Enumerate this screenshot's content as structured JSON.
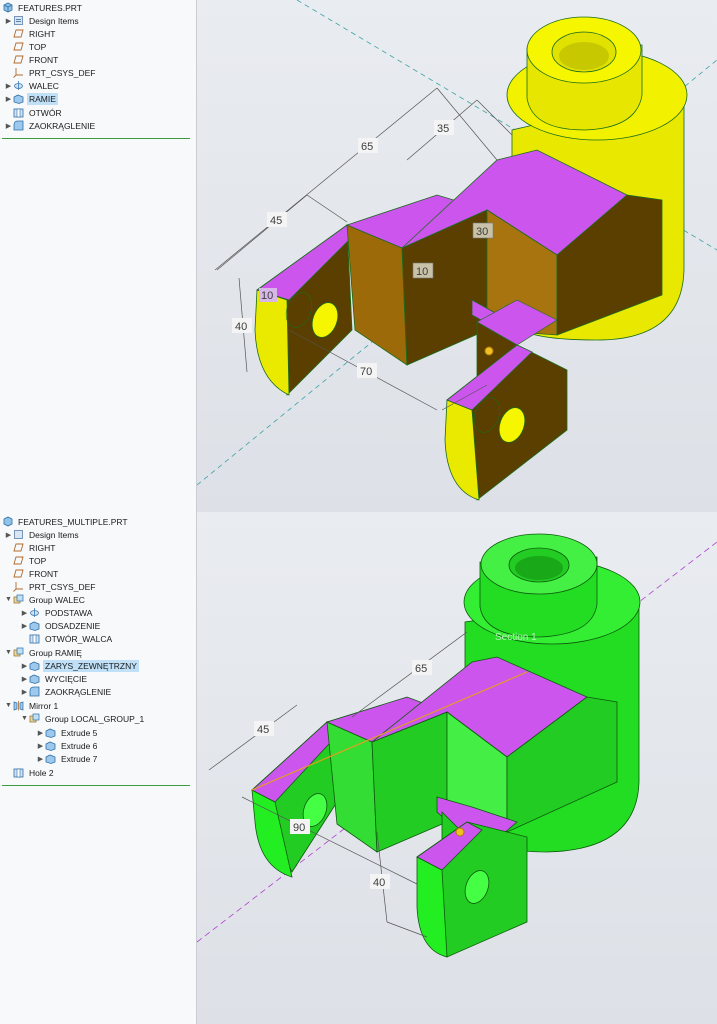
{
  "top": {
    "tree": {
      "root": "FEATURES.PRT",
      "items": [
        {
          "label": "Design Items",
          "icon": "design-items-icon"
        },
        {
          "label": "RIGHT",
          "icon": "datum-plane-icon"
        },
        {
          "label": "TOP",
          "icon": "datum-plane-icon"
        },
        {
          "label": "FRONT",
          "icon": "datum-plane-icon"
        },
        {
          "label": "PRT_CSYS_DEF",
          "icon": "csys-icon"
        },
        {
          "label": "WALEC",
          "icon": "revolve-icon"
        },
        {
          "label": "RAMIE",
          "icon": "extrude-icon"
        },
        {
          "label": "OTWÓR",
          "icon": "hole-icon"
        },
        {
          "label": "ZAOKRĄGLENIE",
          "icon": "round-icon"
        }
      ]
    },
    "dims": {
      "d65": "65",
      "d35": "35",
      "d45": "45",
      "d30": "30",
      "d10a": "10",
      "d10b": "10",
      "d40": "40",
      "d70": "70"
    }
  },
  "bottom": {
    "tree": {
      "root": "FEATURES_MULTIPLE.PRT",
      "items": [
        {
          "label": "Design Items"
        },
        {
          "label": "RIGHT"
        },
        {
          "label": "TOP"
        },
        {
          "label": "FRONT"
        },
        {
          "label": "PRT_CSYS_DEF"
        },
        {
          "label": "Group WALEC"
        },
        {
          "label": "PODSTAWA"
        },
        {
          "label": "ODSADZENIE"
        },
        {
          "label": "OTWÓR_WALCA"
        },
        {
          "label": "Group RAMIĘ"
        },
        {
          "label": "ZARYS_ZEWNĘTRZNY"
        },
        {
          "label": "WYCIĘCIE"
        },
        {
          "label": "ZAOKRĄGLENIE"
        },
        {
          "label": "Mirror 1"
        },
        {
          "label": "Group LOCAL_GROUP_1"
        },
        {
          "label": "Extrude 5"
        },
        {
          "label": "Extrude 6"
        },
        {
          "label": "Extrude 7"
        },
        {
          "label": "Hole 2"
        }
      ]
    },
    "dims": {
      "d65": "65",
      "d45": "45",
      "d90": "90",
      "d40": "40"
    },
    "section_label": "Section 1"
  },
  "colors": {
    "yellow": "#f2f200",
    "dark_brown": "#5a3f00",
    "orange": "#b07a10",
    "magenta": "#cc55ee",
    "green": "#22ee22",
    "dark_green": "#1a8a1a"
  }
}
